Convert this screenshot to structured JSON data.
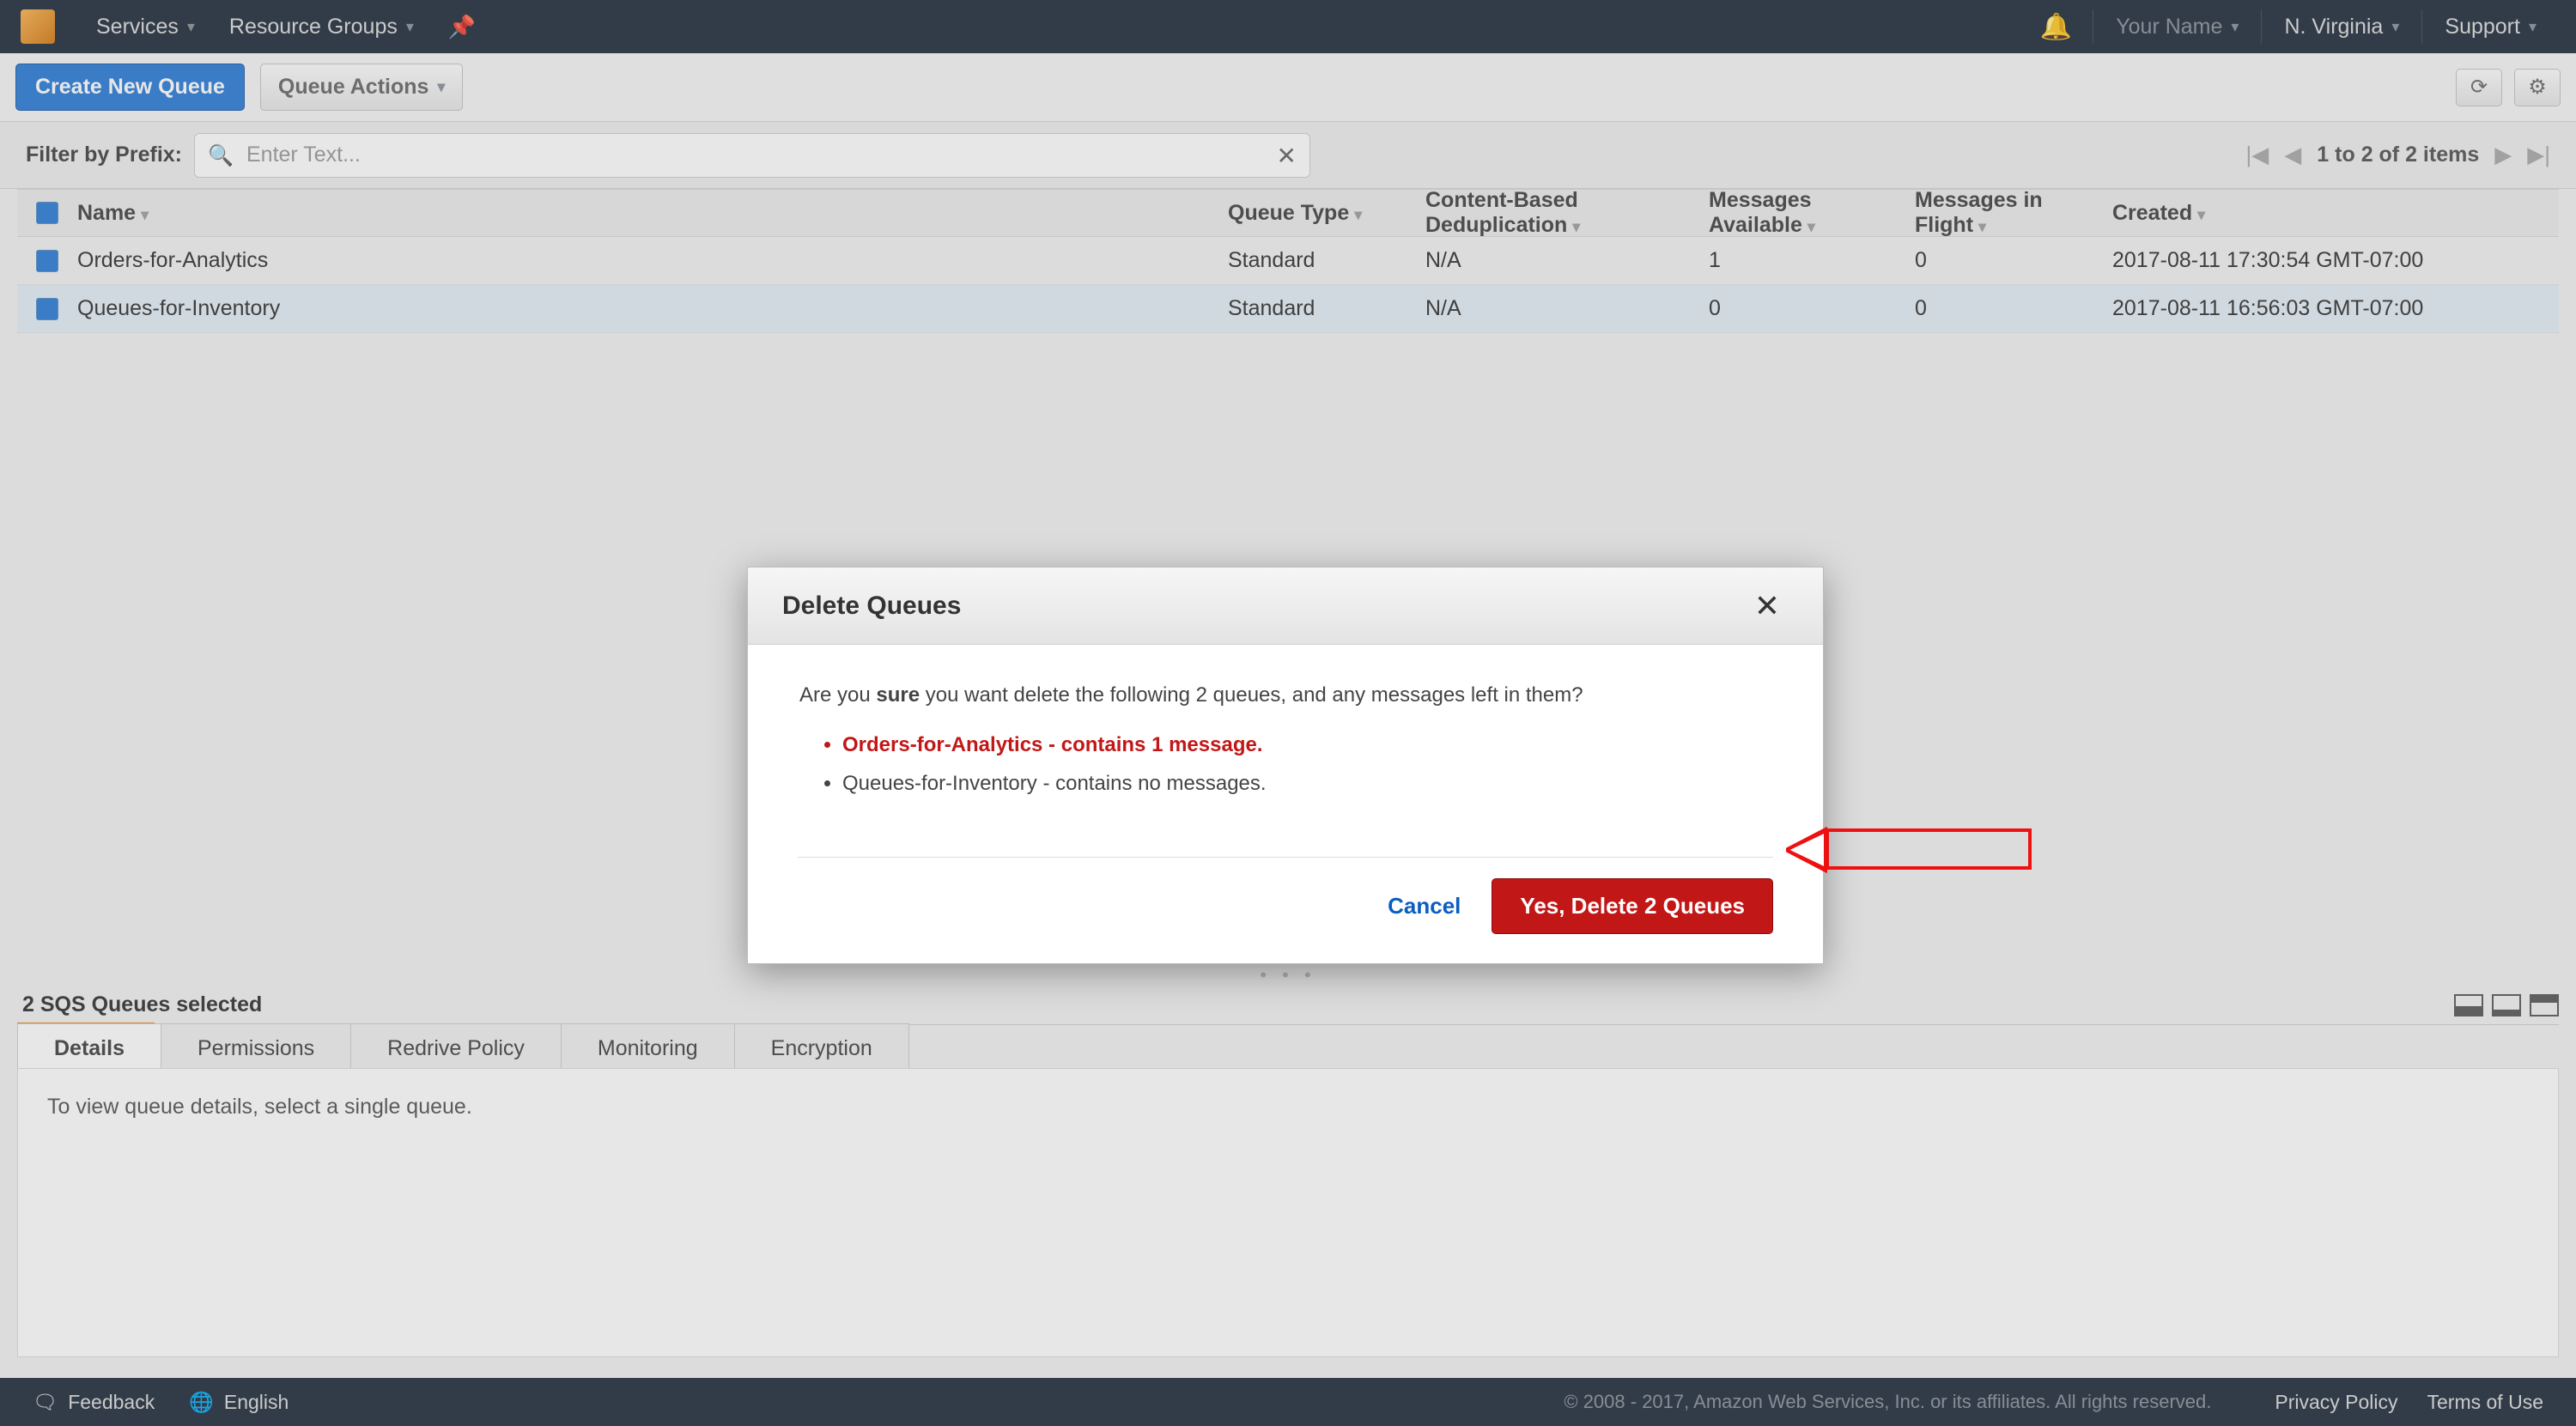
{
  "topnav": {
    "services": "Services",
    "resource_groups": "Resource Groups",
    "user": "Your Name",
    "region": "N. Virginia",
    "support": "Support"
  },
  "toolbar": {
    "create": "Create New Queue",
    "actions": "Queue Actions"
  },
  "filter": {
    "label": "Filter by Prefix:",
    "placeholder": "Enter Text...",
    "pager": "1 to 2 of 2 items"
  },
  "columns": {
    "name": "Name",
    "type": "Queue Type",
    "dedup": "Content-Based Deduplication",
    "avail": "Messages Available",
    "flight": "Messages in Flight",
    "created": "Created"
  },
  "rows": [
    {
      "name": "Orders-for-Analytics",
      "type": "Standard",
      "dedup": "N/A",
      "avail": "1",
      "flight": "0",
      "created": "2017-08-11 17:30:54 GMT-07:00"
    },
    {
      "name": "Queues-for-Inventory",
      "type": "Standard",
      "dedup": "N/A",
      "avail": "0",
      "flight": "0",
      "created": "2017-08-11 16:56:03 GMT-07:00"
    }
  ],
  "detail": {
    "selected": "2 SQS Queues selected",
    "tabs": {
      "details": "Details",
      "permissions": "Permissions",
      "redrive": "Redrive Policy",
      "monitoring": "Monitoring",
      "encryption": "Encryption"
    },
    "body": "To view queue details, select a single queue."
  },
  "footer": {
    "feedback": "Feedback",
    "language": "English",
    "copy": "© 2008 - 2017, Amazon Web Services, Inc. or its affiliates. All rights reserved.",
    "privacy": "Privacy Policy",
    "terms": "Terms of Use"
  },
  "modal": {
    "title": "Delete Queues",
    "pre": "Are you ",
    "sure": "sure",
    "post": " you want delete the following 2 queues, and any messages left in them?",
    "item1": "Orders-for-Analytics - contains 1 message.",
    "item2": "Queues-for-Inventory - contains no messages.",
    "cancel": "Cancel",
    "confirm": "Yes, Delete 2 Queues"
  }
}
